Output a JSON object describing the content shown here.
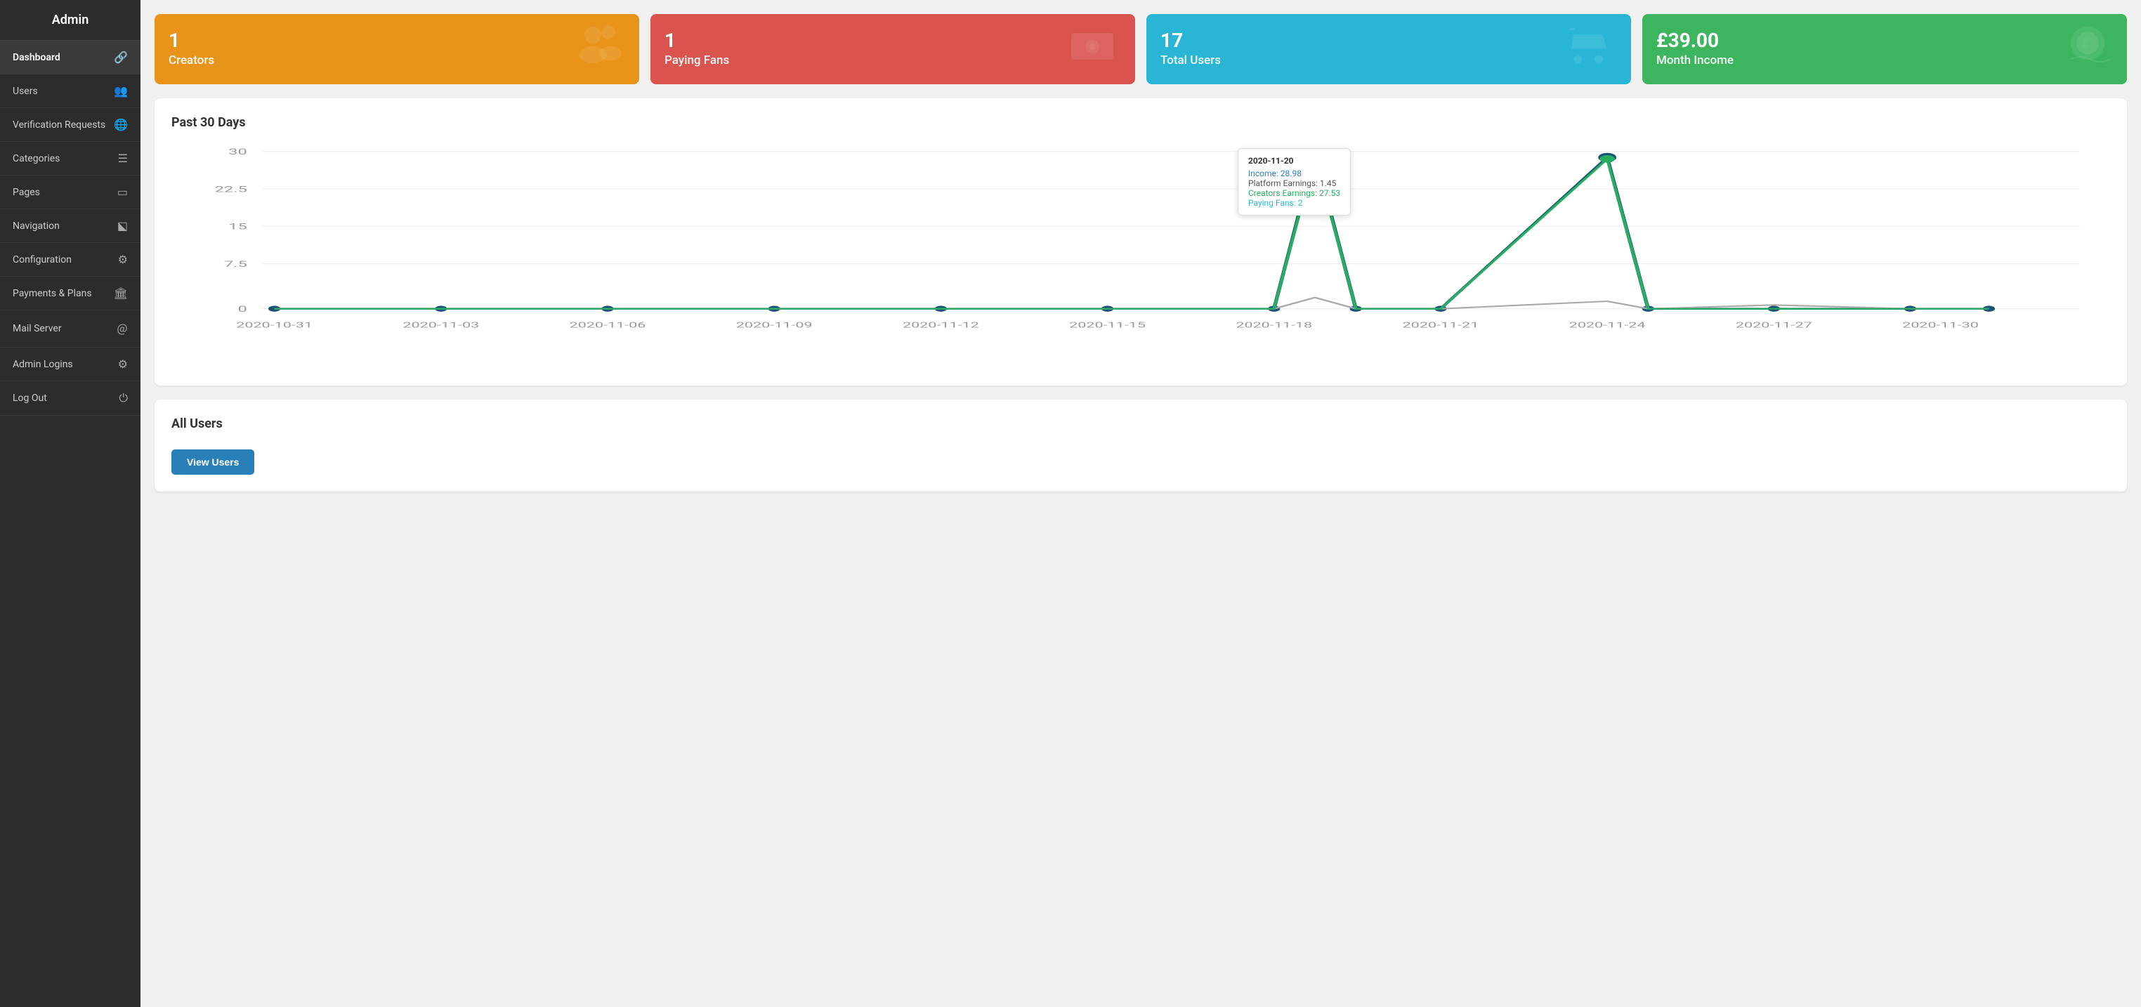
{
  "sidebar": {
    "title": "Admin",
    "items": [
      {
        "label": "Dashboard",
        "icon": "🔗",
        "active": true
      },
      {
        "label": "Users",
        "icon": "👥"
      },
      {
        "label": "Verification Requests",
        "icon": "🌐"
      },
      {
        "label": "Categories",
        "icon": "☰"
      },
      {
        "label": "Pages",
        "icon": "▢"
      },
      {
        "label": "Navigation",
        "icon": "⬕"
      },
      {
        "label": "Configuration",
        "icon": "⚙"
      },
      {
        "label": "Payments & Plans",
        "icon": "🏛"
      },
      {
        "label": "Mail Server",
        "icon": "＠"
      },
      {
        "label": "Admin Logins",
        "icon": "⚙"
      },
      {
        "label": "Log Out",
        "icon": "⏻"
      }
    ]
  },
  "stats": [
    {
      "number": "1",
      "label": "Creators",
      "color": "orange",
      "icon": "👥"
    },
    {
      "number": "1",
      "label": "Paying Fans",
      "color": "red",
      "icon": "💵"
    },
    {
      "number": "17",
      "label": "Total Users",
      "color": "cyan",
      "icon": "🛒"
    },
    {
      "number": "£39.00",
      "label": "Month Income",
      "color": "green",
      "icon": "💰"
    }
  ],
  "chart": {
    "title": "Past 30 Days",
    "tooltip": {
      "date": "2020-11-20",
      "income_label": "Income:",
      "income_value": "28.98",
      "platform_label": "Platform Earnings:",
      "platform_value": "1.45",
      "creators_label": "Creators Earnings:",
      "creators_value": "27.53",
      "fans_label": "Paying Fans:",
      "fans_value": "2"
    },
    "yAxis": [
      "30",
      "22.5",
      "15",
      "7.5",
      "0"
    ],
    "xLabels": [
      "2020-10-31",
      "2020-11-03",
      "2020-11-06",
      "2020-11-09",
      "2020-11-12",
      "2020-11-15",
      "2020-11-18",
      "2020-11-21",
      "2020-11-24",
      "2020-11-27",
      "2020-11-30"
    ]
  },
  "all_users": {
    "title": "All Users",
    "button_label": "View Users"
  }
}
